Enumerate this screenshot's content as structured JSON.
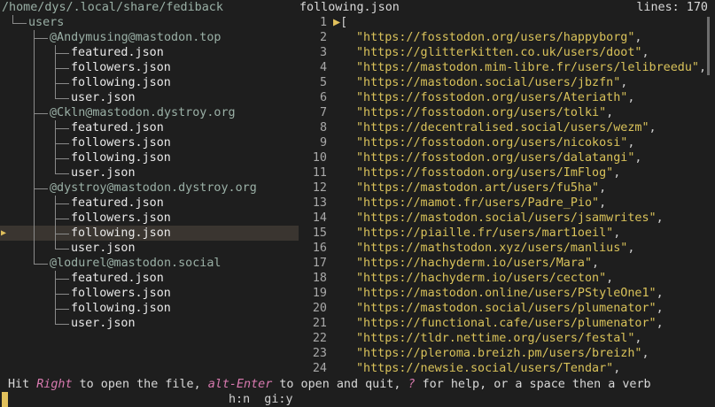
{
  "tree": {
    "root_path": "/home/dys/.local/share/fediback",
    "rows": [
      {
        "label": "users",
        "kind": "dir",
        "depth": 1,
        "selected": false
      },
      {
        "label": "@Andymusing@mastodon.top",
        "kind": "dir",
        "depth": 2,
        "selected": false
      },
      {
        "label": "featured.json",
        "kind": "file",
        "depth": 3,
        "selected": false
      },
      {
        "label": "followers.json",
        "kind": "file",
        "depth": 3,
        "selected": false
      },
      {
        "label": "following.json",
        "kind": "file",
        "depth": 3,
        "selected": false
      },
      {
        "label": "user.json",
        "kind": "file",
        "depth": 3,
        "selected": false
      },
      {
        "label": "@Ckln@mastodon.dystroy.org",
        "kind": "dir",
        "depth": 2,
        "selected": false
      },
      {
        "label": "featured.json",
        "kind": "file",
        "depth": 3,
        "selected": false
      },
      {
        "label": "followers.json",
        "kind": "file",
        "depth": 3,
        "selected": false
      },
      {
        "label": "following.json",
        "kind": "file",
        "depth": 3,
        "selected": false
      },
      {
        "label": "user.json",
        "kind": "file",
        "depth": 3,
        "selected": false
      },
      {
        "label": "@dystroy@mastodon.dystroy.org",
        "kind": "dir",
        "depth": 2,
        "selected": false
      },
      {
        "label": "featured.json",
        "kind": "file",
        "depth": 3,
        "selected": false
      },
      {
        "label": "followers.json",
        "kind": "file",
        "depth": 3,
        "selected": false
      },
      {
        "label": "following.json",
        "kind": "file",
        "depth": 3,
        "selected": true
      },
      {
        "label": "user.json",
        "kind": "file",
        "depth": 3,
        "selected": false
      },
      {
        "label": "@lodurel@mastodon.social",
        "kind": "dir",
        "depth": 2,
        "selected": false
      },
      {
        "label": "featured.json",
        "kind": "file",
        "depth": 3,
        "selected": false
      },
      {
        "label": "followers.json",
        "kind": "file",
        "depth": 3,
        "selected": false
      },
      {
        "label": "following.json",
        "kind": "file",
        "depth": 3,
        "selected": false
      },
      {
        "label": "user.json",
        "kind": "file",
        "depth": 3,
        "selected": false
      }
    ],
    "selection_marker": "▶"
  },
  "preview": {
    "title": "following.json",
    "lines_label": "lines: 170",
    "rows": [
      {
        "num": "1",
        "text": "[",
        "kind": "open"
      },
      {
        "num": "2",
        "text": "\"https://fosstodon.org/users/happyborg\","
      },
      {
        "num": "3",
        "text": "\"https://glitterkitten.co.uk/users/doot\","
      },
      {
        "num": "4",
        "text": "\"https://mastodon.mim-libre.fr/users/lelibreedu\","
      },
      {
        "num": "5",
        "text": "\"https://mastodon.social/users/jbzfn\","
      },
      {
        "num": "6",
        "text": "\"https://fosstodon.org/users/Ateriath\","
      },
      {
        "num": "7",
        "text": "\"https://fosstodon.org/users/tolki\","
      },
      {
        "num": "8",
        "text": "\"https://decentralised.social/users/wezm\","
      },
      {
        "num": "9",
        "text": "\"https://fosstodon.org/users/nicokosi\","
      },
      {
        "num": "10",
        "text": "\"https://fosstodon.org/users/dalatangi\","
      },
      {
        "num": "11",
        "text": "\"https://fosstodon.org/users/ImFlog\","
      },
      {
        "num": "12",
        "text": "\"https://mastodon.art/users/fu5ha\","
      },
      {
        "num": "13",
        "text": "\"https://mamot.fr/users/Padre_Pio\","
      },
      {
        "num": "14",
        "text": "\"https://mastodon.social/users/jsamwrites\","
      },
      {
        "num": "15",
        "text": "\"https://piaille.fr/users/mart1oeil\","
      },
      {
        "num": "16",
        "text": "\"https://mathstodon.xyz/users/manlius\","
      },
      {
        "num": "17",
        "text": "\"https://hachyderm.io/users/Mara\","
      },
      {
        "num": "18",
        "text": "\"https://hachyderm.io/users/cecton\","
      },
      {
        "num": "19",
        "text": "\"https://mastodon.online/users/PStyleOne1\","
      },
      {
        "num": "20",
        "text": "\"https://mastodon.social/users/plumenator\","
      },
      {
        "num": "21",
        "text": "\"https://functional.cafe/users/plumenator\","
      },
      {
        "num": "22",
        "text": "\"https://tldr.nettime.org/users/festal\","
      },
      {
        "num": "23",
        "text": "\"https://pleroma.breizh.pm/users/breizh\","
      },
      {
        "num": "24",
        "text": "\"https://newsie.social/users/Tendar\","
      }
    ]
  },
  "status": {
    "p1": "Hit ",
    "k1": "Right",
    "p2": " to open the file, ",
    "k2": "alt-Enter",
    "p3": " to open and quit, ",
    "k3": "?",
    "p4": " for help, or a space then a verb"
  },
  "input": {
    "mode": "h:n  gi:y"
  }
}
